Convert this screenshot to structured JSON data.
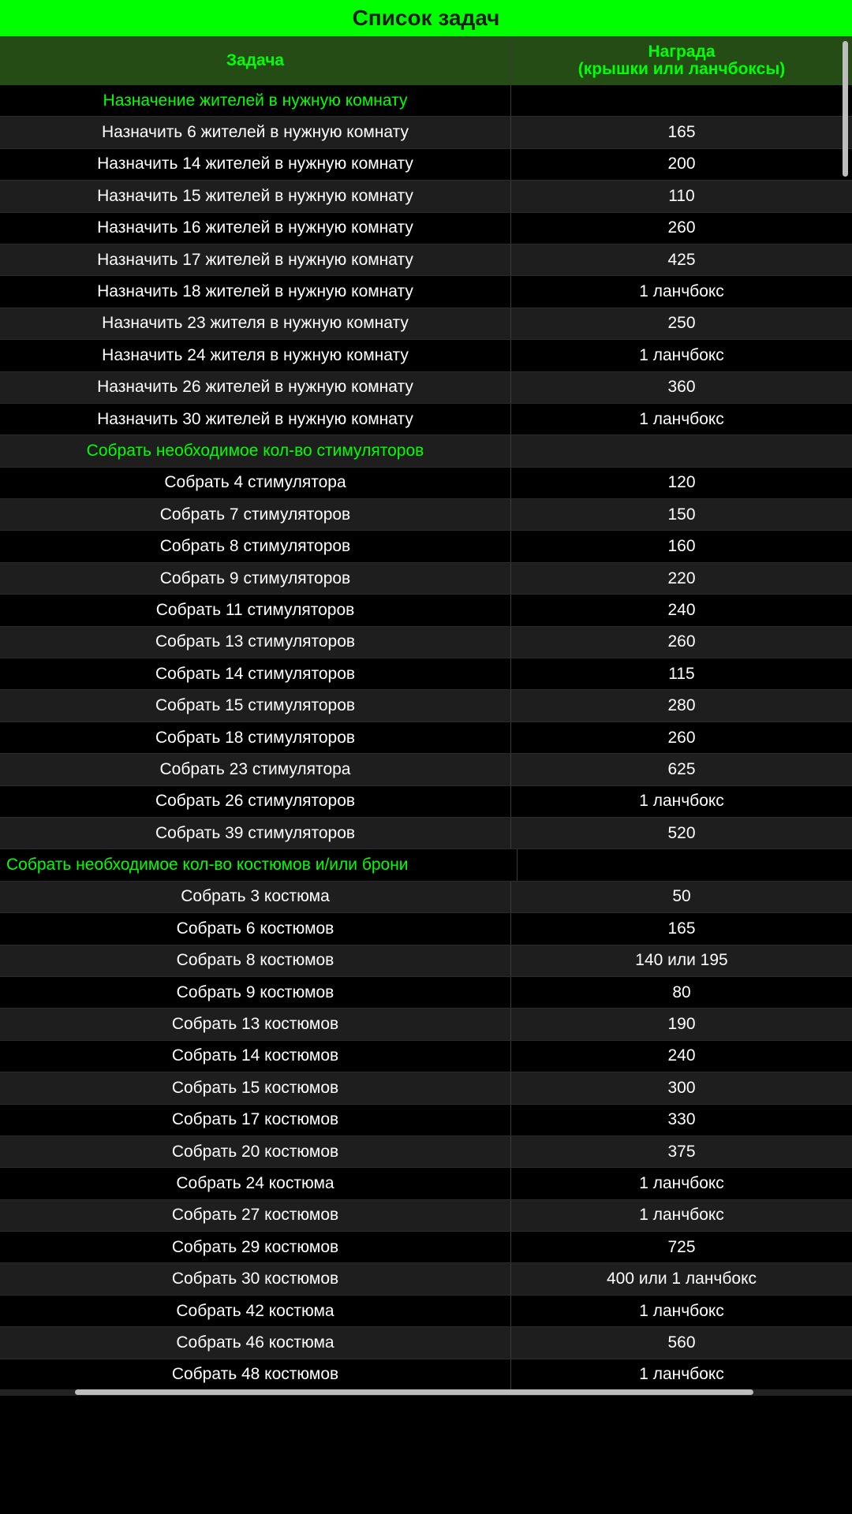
{
  "title": "Список задач",
  "header": {
    "task": "Задача",
    "reward_line1": "Награда",
    "reward_line2": "(крышки или ланчбоксы)"
  },
  "rows": [
    {
      "task": "Назначение жителей в нужную комнату",
      "reward": "",
      "section": true,
      "align": "center"
    },
    {
      "task": "Назначить 6 жителей в нужную комнату",
      "reward": "165"
    },
    {
      "task": "Назначить 14 жителей в нужную комнату",
      "reward": "200"
    },
    {
      "task": "Назначить 15 жителей в нужную комнату",
      "reward": "110"
    },
    {
      "task": "Назначить 16 жителей в нужную комнату",
      "reward": "260"
    },
    {
      "task": "Назначить 17 жителей в нужную комнату",
      "reward": "425"
    },
    {
      "task": "Назначить 18 жителей в нужную комнату",
      "reward": "1 ланчбокс"
    },
    {
      "task": "Назначить 23 жителя в нужную комнату",
      "reward": "250"
    },
    {
      "task": "Назначить 24 жителя в нужную комнату",
      "reward": "1 ланчбокс"
    },
    {
      "task": "Назначить 26 жителей в нужную комнату",
      "reward": "360"
    },
    {
      "task": "Назначить 30 жителей в нужную комнату",
      "reward": "1 ланчбокс"
    },
    {
      "task": "Собрать необходимое кол-во стимуляторов",
      "reward": "",
      "section": true,
      "align": "center"
    },
    {
      "task": "Собрать 4 стимулятора",
      "reward": "120"
    },
    {
      "task": "Собрать 7 стимуляторов",
      "reward": "150"
    },
    {
      "task": "Собрать 8 стимуляторов",
      "reward": "160"
    },
    {
      "task": "Собрать 9 стимуляторов",
      "reward": "220"
    },
    {
      "task": "Собрать 11 стимуляторов",
      "reward": "240"
    },
    {
      "task": "Собрать 13 стимуляторов",
      "reward": "260"
    },
    {
      "task": "Собрать 14 стимуляторов",
      "reward": "115"
    },
    {
      "task": "Собрать 15 стимуляторов",
      "reward": "280"
    },
    {
      "task": "Собрать 18 стимуляторов",
      "reward": "260"
    },
    {
      "task": "Собрать 23 стимулятора",
      "reward": "625"
    },
    {
      "task": "Собрать 26 стимуляторов",
      "reward": "1 ланчбокс"
    },
    {
      "task": "Собрать 39 стимуляторов",
      "reward": "520"
    },
    {
      "task": "Собрать необходимое кол-во костюмов и/или брони",
      "reward": "",
      "section": true,
      "align": "left"
    },
    {
      "task": "Собрать 3 костюма",
      "reward": "50"
    },
    {
      "task": "Собрать 6 костюмов",
      "reward": "165"
    },
    {
      "task": "Собрать 8 костюмов",
      "reward": "140 или 195"
    },
    {
      "task": "Собрать 9 костюмов",
      "reward": "80"
    },
    {
      "task": "Собрать 13 костюмов",
      "reward": "190"
    },
    {
      "task": "Собрать 14 костюмов",
      "reward": "240"
    },
    {
      "task": "Собрать 15 костюмов",
      "reward": "300"
    },
    {
      "task": "Собрать 17 костюмов",
      "reward": "330"
    },
    {
      "task": "Собрать 20 костюмов",
      "reward": "375"
    },
    {
      "task": "Собрать 24 костюма",
      "reward": "1 ланчбокс"
    },
    {
      "task": "Собрать 27 костюмов",
      "reward": "1 ланчбокс"
    },
    {
      "task": "Собрать 29 костюмов",
      "reward": "725"
    },
    {
      "task": "Собрать 30 костюмов",
      "reward": "400 или 1 ланчбокс"
    },
    {
      "task": "Собрать 42 костюма",
      "reward": "1 ланчбокс"
    },
    {
      "task": "Собрать 46 костюма",
      "reward": "560"
    },
    {
      "task": "Собрать 48 костюмов",
      "reward": "1 ланчбокс"
    }
  ]
}
